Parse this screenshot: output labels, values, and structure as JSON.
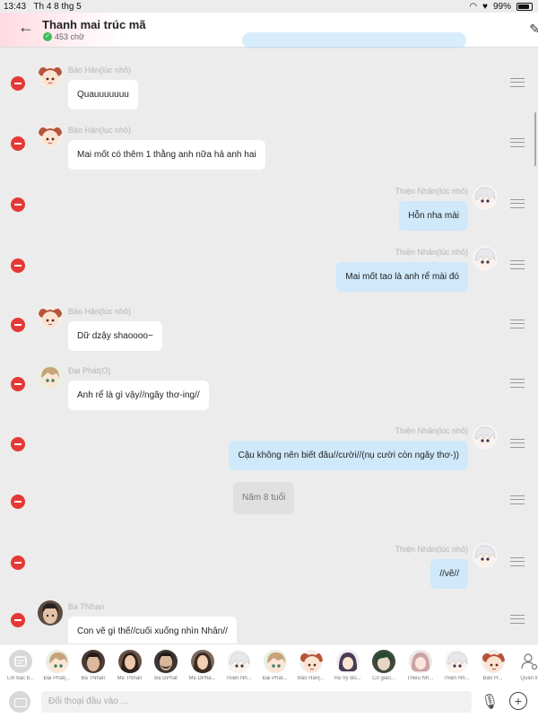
{
  "status": {
    "time": "13:43",
    "date": "Th 4 8 thg 5",
    "battery": "99%"
  },
  "header": {
    "title": "Thanh mai trúc mã",
    "word_count": "453 chữ"
  },
  "messages": [
    {
      "side": "left",
      "name": "Bảo Hân(lúc nhỏ)",
      "text": "Quauuuuuuu",
      "avatar": "bao-han"
    },
    {
      "side": "left",
      "name": "Bảo Hân(lúc nhỏ)",
      "text": "Mai mốt có thêm 1 thằng anh nữa hả anh hai",
      "avatar": "bao-han"
    },
    {
      "side": "right",
      "name": "Thiện Nhân(lúc nhỏ)",
      "text": "Hỗn nha mài",
      "avatar": "thien-nhan"
    },
    {
      "side": "right",
      "name": "Thiện Nhân(lúc nhỏ)",
      "text": "Mai mốt tao là anh rể mài đó",
      "avatar": "thien-nhan"
    },
    {
      "side": "left",
      "name": "Bảo Hân(lúc nhỏ)",
      "text": "Dữ dzậy shaoooo~",
      "avatar": "bao-han"
    },
    {
      "side": "left",
      "name": "Đại Phát(O)",
      "text": "Anh rể là gì vậy//ngây thơ-ing//",
      "avatar": "dai-phat"
    },
    {
      "side": "right",
      "name": "Thiện Nhân(lúc nhỏ)",
      "text": "Cậu không nên biết đâu//cười//(nụ cười còn ngây thơ-))",
      "avatar": "thien-nhan"
    },
    {
      "side": "center",
      "name": "",
      "text": "Năm 8 tuổi",
      "avatar": ""
    },
    {
      "side": "right",
      "name": "Thiện Nhân(lúc nhỏ)",
      "text": "//vẽ//",
      "avatar": "thien-nhan"
    },
    {
      "side": "left",
      "name": "Ba TNhan",
      "text": "Con vẽ gì thế//cuối xuống nhìn Nhân//",
      "avatar": "ba-tnhan"
    }
  ],
  "characters": [
    {
      "label": "Lời bắc b...",
      "type": "narration"
    },
    {
      "label": "Đại Phát(...",
      "type": "dai-phat"
    },
    {
      "label": "Ba TNhan",
      "type": "man-dark"
    },
    {
      "label": "Mẹ TNhan",
      "type": "woman-dark"
    },
    {
      "label": "Ba DPhat",
      "type": "man-beard"
    },
    {
      "label": "Mẹ DPha...",
      "type": "woman-dark2"
    },
    {
      "label": "Thiện Nh...",
      "type": "thien-nhan"
    },
    {
      "label": "Đại Phát...",
      "type": "dai-phat"
    },
    {
      "label": "Bảo Hân(...",
      "type": "bao-han"
    },
    {
      "label": "Hà Vy Bù...",
      "type": "girl-purple"
    },
    {
      "label": "Cô giáo...",
      "type": "green"
    },
    {
      "label": "Thiều Nh...",
      "type": "pink"
    },
    {
      "label": "Thiện Nh...",
      "type": "thien-nhan"
    },
    {
      "label": "Bảo H...",
      "type": "bao-han"
    },
    {
      "label": "Quản lí",
      "type": "manage"
    }
  ],
  "input": {
    "placeholder": "Đối thoại đầu vào ..."
  },
  "colors": {
    "delete": "#e53935",
    "right_bubble": "#cfe8fa",
    "left_bubble": "#ffffff",
    "background": "#ececec"
  }
}
